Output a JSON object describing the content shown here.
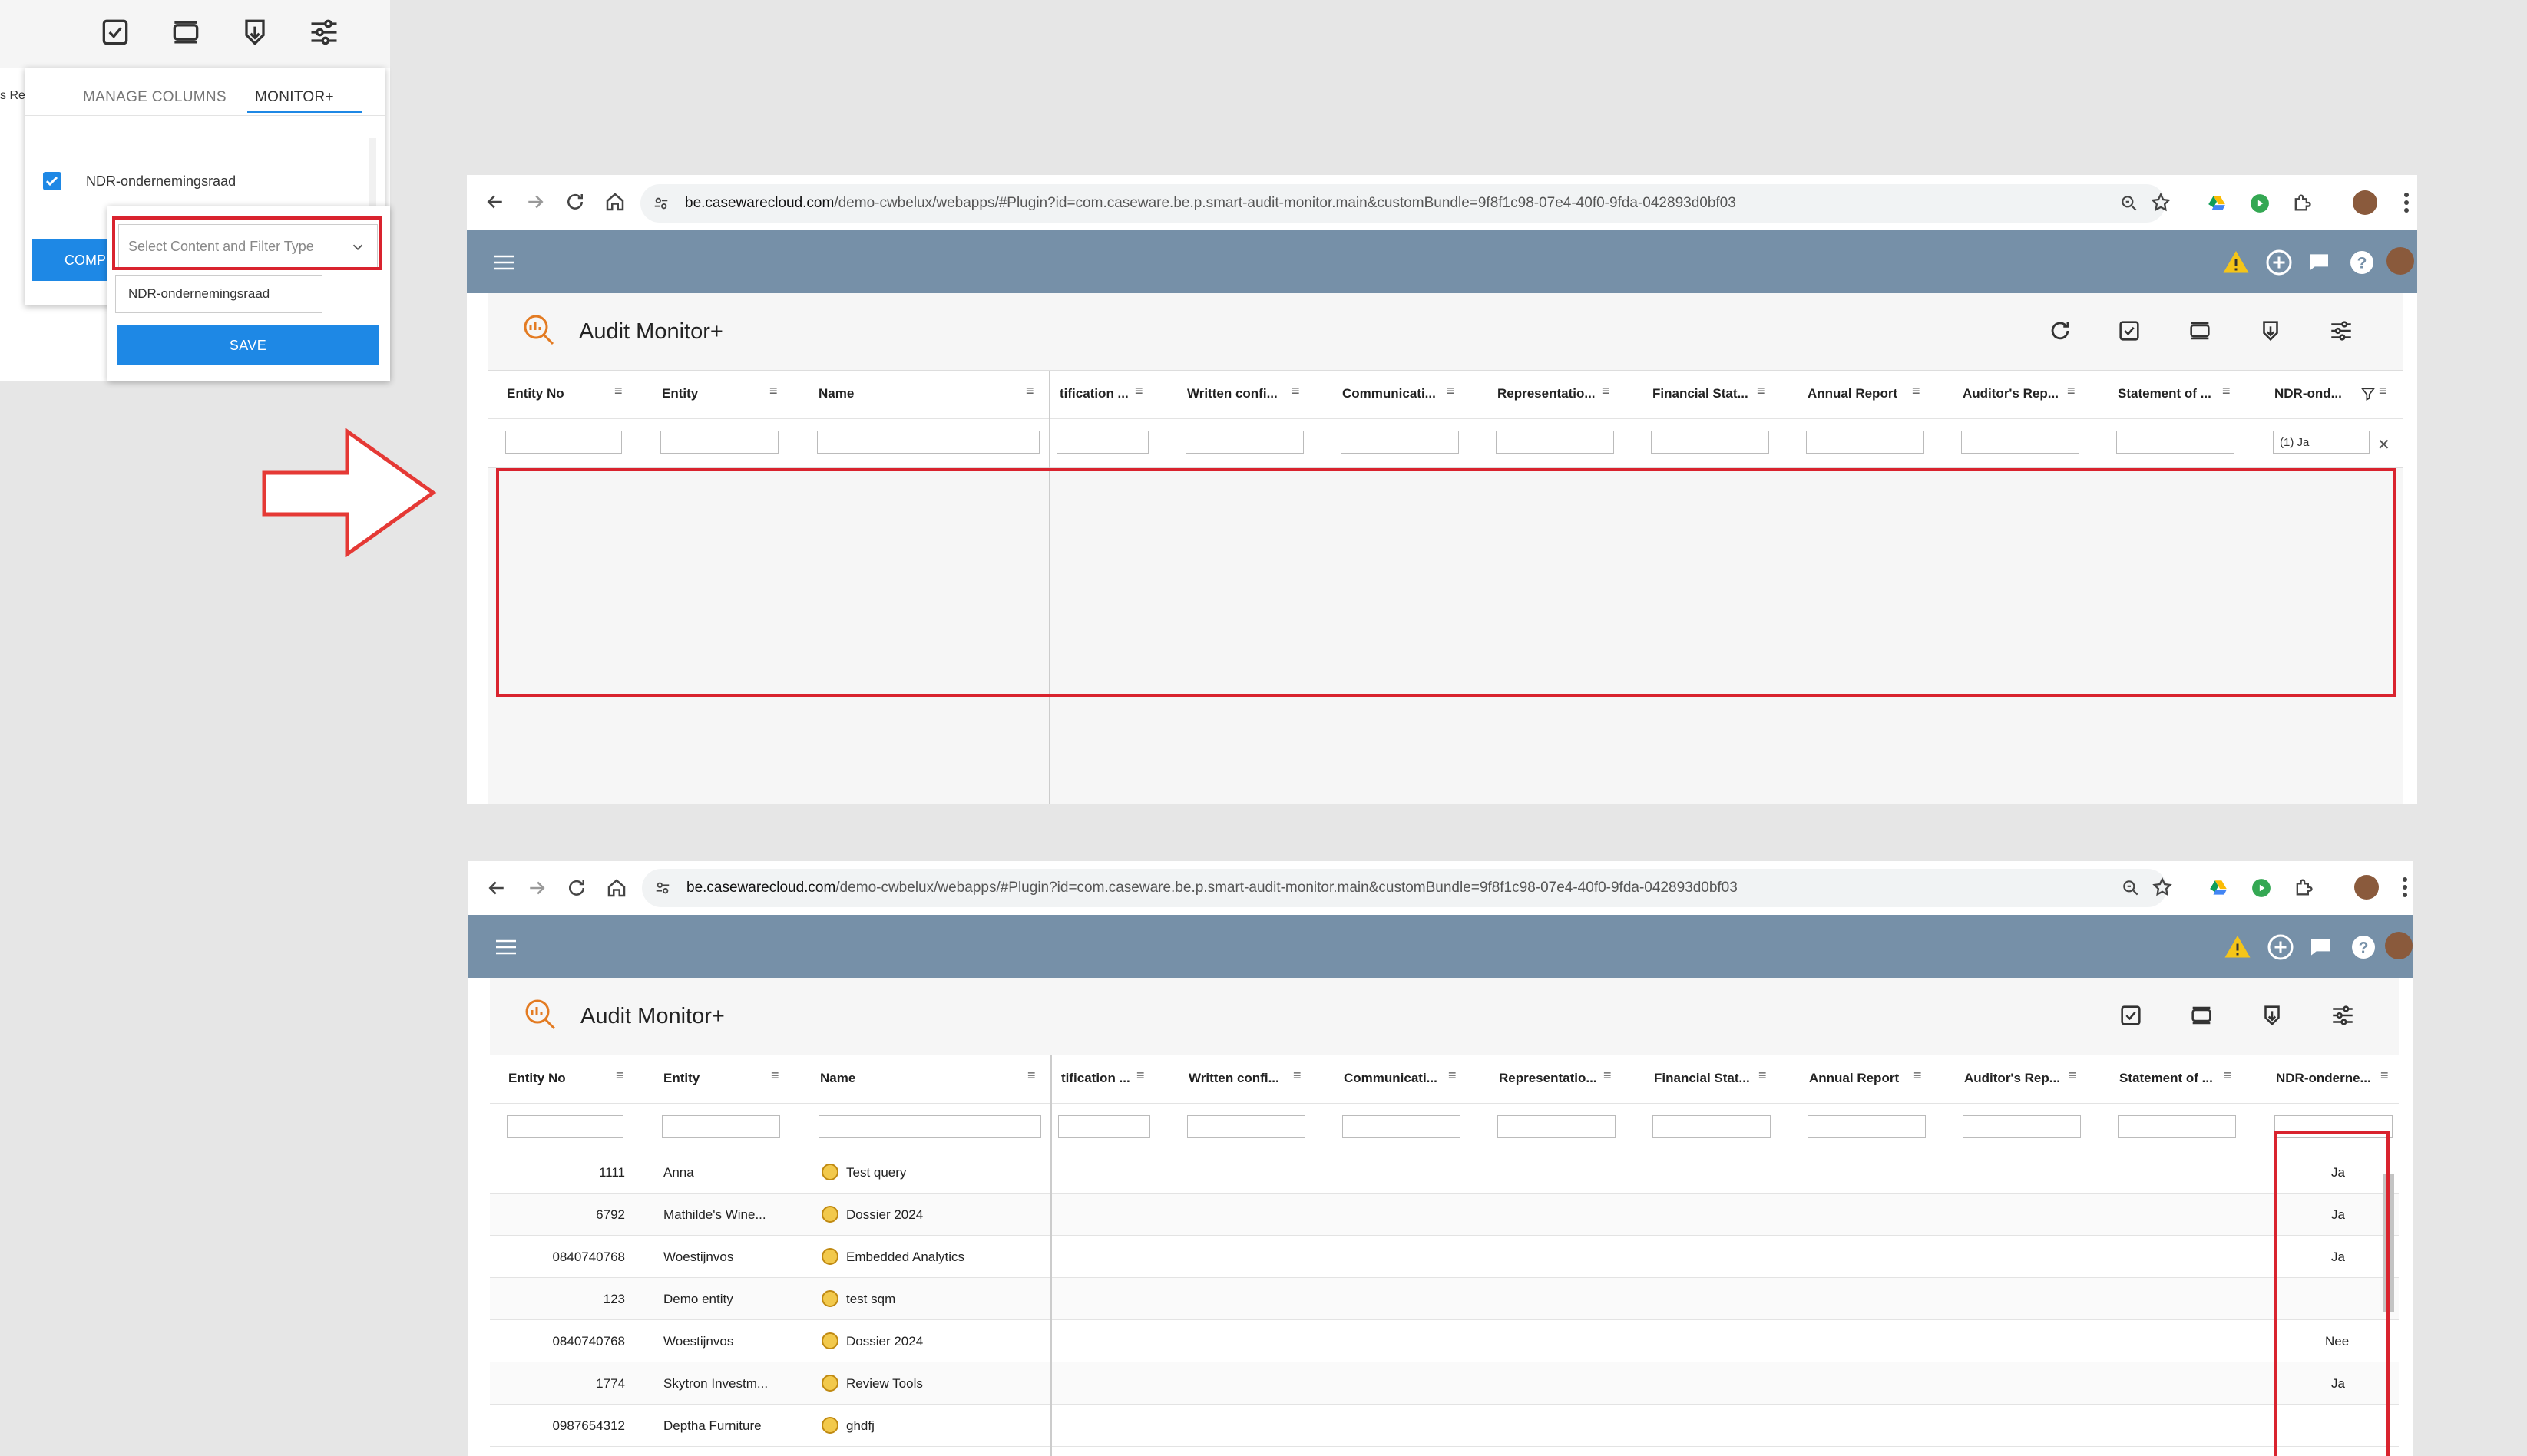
{
  "popup": {
    "tabs": [
      {
        "label": "MANAGE COLUMNS",
        "active": false
      },
      {
        "label": "MONITOR+",
        "active": true
      }
    ],
    "column_checkbox_label": "NDR-ondernemingsraad",
    "left_edge_text": "s Re",
    "comp_button_label": "COMP",
    "select_placeholder": "Select Content and Filter Type",
    "name_input_value": "NDR-ondernemingsraad",
    "save_button_label": "SAVE",
    "toolbar_icons": [
      "checklist-icon",
      "rows-icon",
      "export-icon",
      "settings-sliders-icon"
    ]
  },
  "colors": {
    "accent_blue": "#1e88e5",
    "highlight_red": "#d9232e",
    "app_header": "#7690a8",
    "warning_yellow": "#f5c518",
    "arrow_red": "#e53935"
  },
  "browser": {
    "url_host": "be.casewarecloud.com",
    "url_path": "/demo-cwbelux/webapps/#Plugin?id=com.caseware.be.p.smart-audit-monitor.main&customBundle=9f8f1c98-07e4-40f0-9fda-042893d0bf03"
  },
  "app": {
    "title": "Audit Monitor+"
  },
  "grid": {
    "columns": [
      "Entity No",
      "Entity",
      "Name",
      "tification ...",
      "Written confi...",
      "Communicati...",
      "Representatio...",
      "Financial Stat...",
      "Annual Report",
      "Auditor's Rep...",
      "Statement of ...",
      "NDR-ond...",
      "NDR-onderne..."
    ],
    "filter_value_top": "(1) Ja",
    "rows": [
      {
        "entity_no": "1111",
        "entity": "Anna",
        "name": "Test query",
        "ndr": "Ja"
      },
      {
        "entity_no": "6792",
        "entity": "Mathilde's Wine...",
        "name": "Dossier 2024",
        "ndr": "Ja"
      },
      {
        "entity_no": "0840740768",
        "entity": "Woestijnvos",
        "name": "Embedded Analytics",
        "ndr": "Ja"
      },
      {
        "entity_no": "123",
        "entity": "Demo entity",
        "name": "test sqm",
        "ndr": ""
      },
      {
        "entity_no": "0840740768",
        "entity": "Woestijnvos",
        "name": "Dossier 2024",
        "ndr": "Nee"
      },
      {
        "entity_no": "1774",
        "entity": "Skytron Investm...",
        "name": "Review Tools",
        "ndr": "Ja"
      },
      {
        "entity_no": "0987654312",
        "entity": "Deptha Furniture",
        "name": "ghdfj",
        "ndr": ""
      }
    ]
  }
}
